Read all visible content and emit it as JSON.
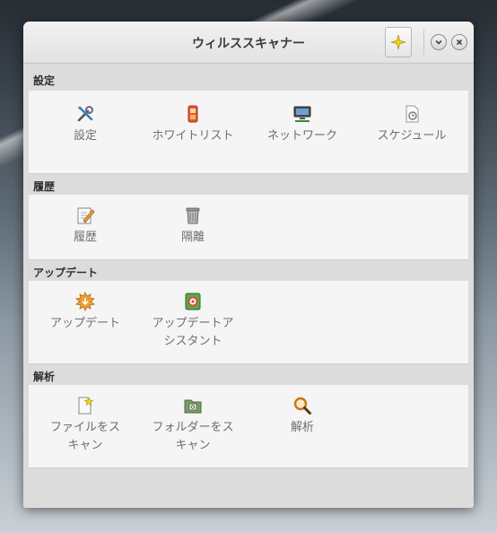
{
  "window": {
    "title": "ウィルススキャナー"
  },
  "sections": [
    {
      "header": "設定",
      "items": [
        {
          "label": "設定",
          "icon": "tools-icon"
        },
        {
          "label": "ホワイトリスト",
          "icon": "whitelist-icon"
        },
        {
          "label": "ネットワーク",
          "icon": "network-icon"
        },
        {
          "label": "スケジュール",
          "icon": "schedule-icon"
        }
      ]
    },
    {
      "header": "履歴",
      "items": [
        {
          "label": "履歴",
          "icon": "history-icon"
        },
        {
          "label": "隔離",
          "icon": "quarantine-icon"
        }
      ]
    },
    {
      "header": "アップデート",
      "items": [
        {
          "label": "アップデート",
          "icon": "update-icon"
        },
        {
          "label1": "アップデートア",
          "label2": "シスタント",
          "icon": "update-assistant-icon"
        }
      ]
    },
    {
      "header": "解析",
      "items": [
        {
          "label1": "ファイルをス",
          "label2": "キャン",
          "icon": "scan-file-icon"
        },
        {
          "label1": "フォルダーをス",
          "label2": "キャン",
          "icon": "scan-folder-icon"
        },
        {
          "label": "解析",
          "icon": "analysis-icon"
        }
      ]
    }
  ],
  "colors": {
    "accent_star": "#f2d21a",
    "update_orange": "#f0a030",
    "green": "#57a84a"
  }
}
